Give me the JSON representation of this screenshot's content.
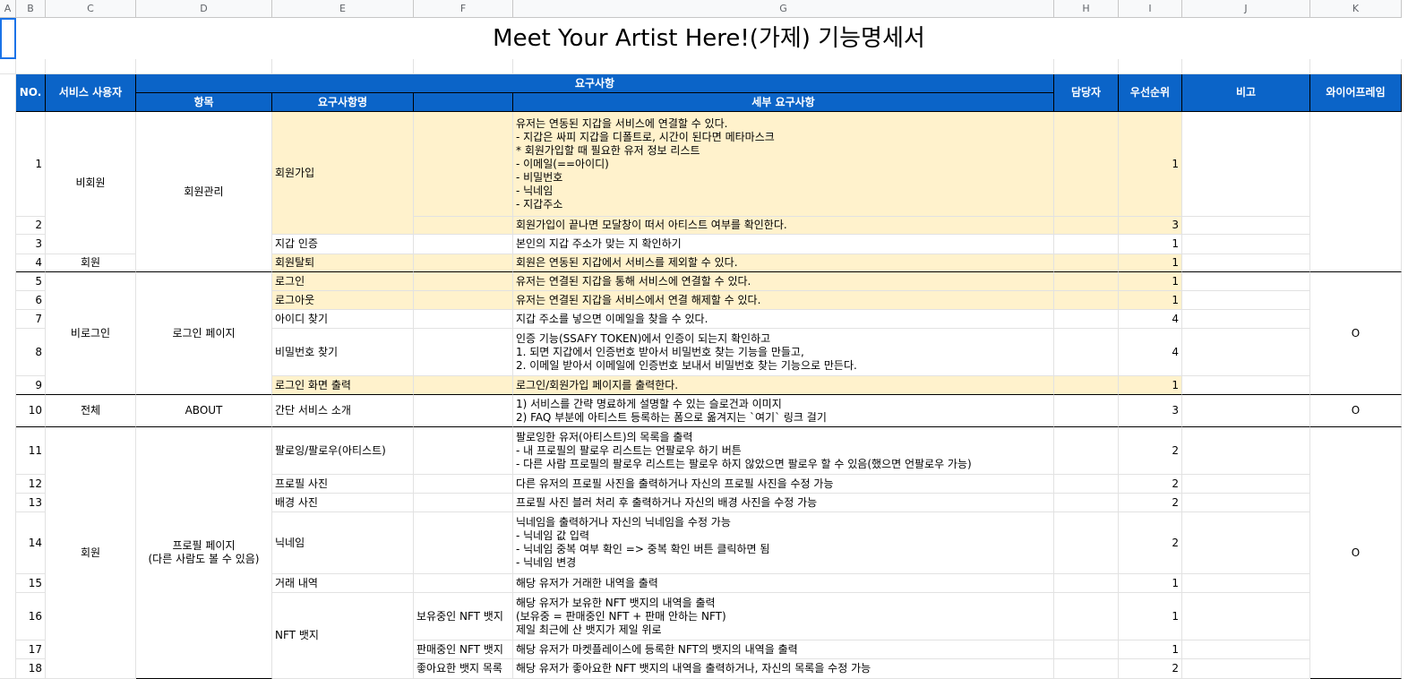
{
  "column_headers": [
    "A",
    "B",
    "C",
    "D",
    "E",
    "F",
    "G",
    "H",
    "I",
    "J",
    "K"
  ],
  "title": "Meet Your Artist Here!(가제) 기능명세서",
  "table_header": {
    "no": "NO.",
    "user": "서비스 사용자",
    "requirements": "요구사항",
    "item": "항목",
    "req_name": "요구사항명",
    "detail": "세부 요구사항",
    "owner": "담당자",
    "priority": "우선순위",
    "note": "비고",
    "wireframe": "와이어프레임"
  },
  "groups": [
    {
      "user": "비회원",
      "item": "회원관리"
    },
    {
      "user": "회원",
      "item": ""
    },
    {
      "user": "비로그인",
      "item": "로그인 페이지",
      "wireframe": "O"
    },
    {
      "user": "전체",
      "item": "ABOUT",
      "wireframe": "O"
    },
    {
      "user": "회원",
      "item": "프로필 페이지\n(다른 사람도 볼 수 있음)",
      "wireframe": "O"
    }
  ],
  "rows": [
    {
      "no": "1",
      "name": "회원가입",
      "sub": "",
      "detail": "유저는 연동된 지갑을 서비스에 연결할 수 있다.\n- 지갑은 싸피 지갑을 디폴트로, 시간이 된다면 메타마스크\n* 회원가입할 때 필요한 유저 정보 리스트\n- 이메일(==아이디)\n- 비밀번호\n- 닉네임\n- 지갑주소",
      "priority": "1"
    },
    {
      "no": "2",
      "name": "",
      "sub": "",
      "detail": "회원가입이 끝나면 모달창이 떠서 아티스트 여부를 확인한다.",
      "priority": "3"
    },
    {
      "no": "3",
      "name": "지갑 인증",
      "sub": "",
      "detail": "본인의 지갑 주소가 맞는 지 확인하기",
      "priority": "1"
    },
    {
      "no": "4",
      "name": "회원탈퇴",
      "sub": "",
      "detail": "회원은 연동된 지갑에서 서비스를 제외할 수 있다.",
      "priority": "1"
    },
    {
      "no": "5",
      "name": "로그인",
      "sub": "",
      "detail": "유저는 연결된 지갑을 통해 서비스에 연결할 수 있다.",
      "priority": "1"
    },
    {
      "no": "6",
      "name": "로그아웃",
      "sub": "",
      "detail": "유저는 연결된 지갑을 서비스에서 연결 해제할 수 있다.",
      "priority": "1"
    },
    {
      "no": "7",
      "name": "아이디 찾기",
      "sub": "",
      "detail": "지갑 주소를 넣으면 이메일을 찾을 수 있다.",
      "priority": "4"
    },
    {
      "no": "8",
      "name": "비밀번호 찾기",
      "sub": "",
      "detail": "인증 기능(SSAFY TOKEN)에서 인증이 되는지 확인하고\n1. 되면 지갑에서 인증번호 받아서 비밀번호 찾는 기능을 만들고,\n2. 이메일 받아서 이메일에 인증번호 보내서 비밀번호 찾는 기능으로 만든다.",
      "priority": "4"
    },
    {
      "no": "9",
      "name": "로그인 화면 출력",
      "sub": "",
      "detail": "로그인/회원가입 페이지를 출력한다.",
      "priority": "1"
    },
    {
      "no": "10",
      "name": "간단 서비스 소개",
      "sub": "",
      "detail": "1) 서비스를 간략 명료하게 설명할 수 있는 슬로건과 이미지\n2) FAQ 부분에 아티스트 등록하는 폼으로 옮겨지는 `여기` 링크 걸기",
      "priority": "3"
    },
    {
      "no": "11",
      "name": "팔로잉/팔로우(아티스트)",
      "sub": "",
      "detail": "팔로잉한 유저(아티스트)의 목록을 출력\n- 내 프로필의 팔로우 리스트는 언팔로우 하기 버튼\n- 다른 사람 프로필의 팔로우 리스트는 팔로우 하지 않았으면 팔로우 할 수 있음(했으면 언팔로우 가능)",
      "priority": "2"
    },
    {
      "no": "12",
      "name": "프로필 사진",
      "sub": "",
      "detail": "다른 유저의 프로필 사진을 출력하거나 자신의 프로필 사진을 수정 가능",
      "priority": "2"
    },
    {
      "no": "13",
      "name": "배경 사진",
      "sub": "",
      "detail": "프로필 사진 블러 처리 후 출력하거나 자신의 배경 사진을 수정 가능",
      "priority": "2"
    },
    {
      "no": "14",
      "name": "닉네임",
      "sub": "",
      "detail": "닉네임을 출력하거나 자신의 닉네임을 수정 가능\n- 닉네임 값 입력\n- 닉네임 중복 여부 확인 => 중복 확인 버튼 클릭하면 됨\n- 닉네임 변경",
      "priority": "2"
    },
    {
      "no": "15",
      "name": "거래 내역",
      "sub": "",
      "detail": "해당 유저가 거래한 내역을 출력",
      "priority": "1"
    },
    {
      "no": "16",
      "name": "NFT 뱃지",
      "sub": "보유중인 NFT 뱃지",
      "detail": "해당 유저가 보유한 NFT 뱃지의 내역을 출력\n(보유중 = 판매중인 NFT + 판매 안하는 NFT)\n제일 최근에 산 뱃지가 제일 위로",
      "priority": "1"
    },
    {
      "no": "17",
      "name": "",
      "sub": "판매중인 NFT 뱃지",
      "detail": "해당 유저가 마켓플레이스에 등록한 NFT의 뱃지의 내역을 출력",
      "priority": "1"
    },
    {
      "no": "18",
      "name": "",
      "sub": "좋아요한 뱃지 목록",
      "detail": "해당 유저가 좋아요한 NFT 뱃지의 내역을 출력하거나, 자신의 목록을 수정 가능",
      "priority": "2"
    }
  ]
}
